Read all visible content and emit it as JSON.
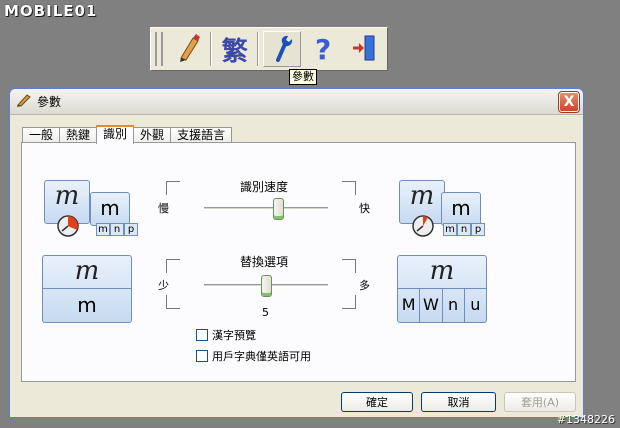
{
  "logo": {
    "text": "MOBILE01"
  },
  "toolbar": {
    "buttons": [
      {
        "name": "pen",
        "label": ""
      },
      {
        "name": "traditional",
        "label": "繁"
      },
      {
        "name": "settings",
        "label": ""
      },
      {
        "name": "help",
        "label": "?"
      },
      {
        "name": "exit",
        "label": ""
      }
    ],
    "tooltip": "參數"
  },
  "dialog": {
    "title": "參數",
    "close_label": "X",
    "tabs": [
      "一般",
      "熱鍵",
      "識別",
      "外觀",
      "支援語言"
    ],
    "active_tab": "識別",
    "speed": {
      "title": "識別速度",
      "min_label": "慢",
      "max_label": "快",
      "value_fraction": 0.6
    },
    "replace": {
      "title": "替換選項",
      "min_label": "少",
      "max_label": "多",
      "value": "5",
      "value_fraction": 0.5
    },
    "icons": {
      "script_glyph": "m",
      "letter": "m",
      "mini_letters": [
        "m",
        "n",
        "p"
      ],
      "right_letters": [
        "M",
        "W",
        "n",
        "u"
      ]
    },
    "checkboxes": [
      {
        "label": "漢字預覽",
        "checked": false
      },
      {
        "label": "用戶字典僅英語可用",
        "checked": false
      }
    ],
    "buttons": {
      "ok": "確定",
      "cancel": "取消",
      "apply": "套用(A)"
    }
  },
  "watermark": "#1348226",
  "colors": {
    "accent_tab": "#e68b2c",
    "close": "#c9462b",
    "slider_thumb": "#7ec36b"
  }
}
